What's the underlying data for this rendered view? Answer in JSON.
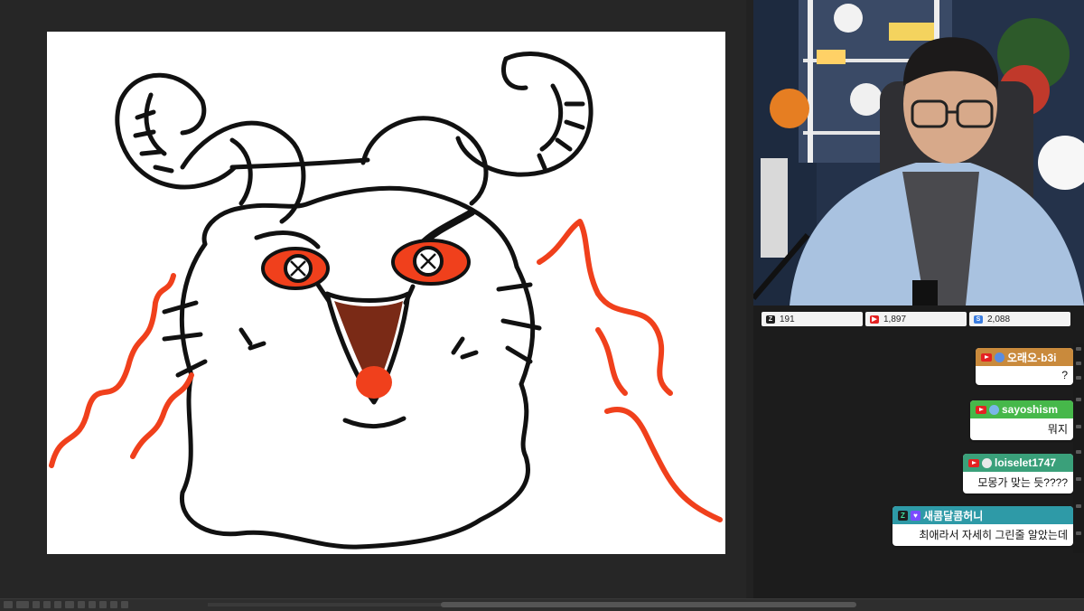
{
  "stream_stats": [
    {
      "platform": "chzzk",
      "icon": "chzzk-icon",
      "count": "191"
    },
    {
      "platform": "youtube",
      "icon": "youtube-icon",
      "count": "1,897"
    },
    {
      "platform": "soop",
      "icon": "soop-icon",
      "count": "2,088"
    }
  ],
  "chat": [
    {
      "platform": "youtube",
      "username": "오래오-b3i",
      "message": "?",
      "header_color": "#c98a3c"
    },
    {
      "platform": "youtube",
      "username": "sayoshism",
      "message": "뭐지",
      "header_color": "#46b84a"
    },
    {
      "platform": "youtube",
      "username": "loiselet1747",
      "message": "모몽가 맞는 듯????",
      "header_color": "#3aa07a"
    },
    {
      "platform": "chzzk",
      "username": "새콤달콤허니",
      "message": "최애라서 자세히 그린줄 알았는데",
      "header_color": "#2e9aa7"
    }
  ],
  "colors": {
    "line_ink": "#111111",
    "accent_red": "#f0401c",
    "canvas_bg": "#ffffff",
    "app_bg": "#262626"
  }
}
